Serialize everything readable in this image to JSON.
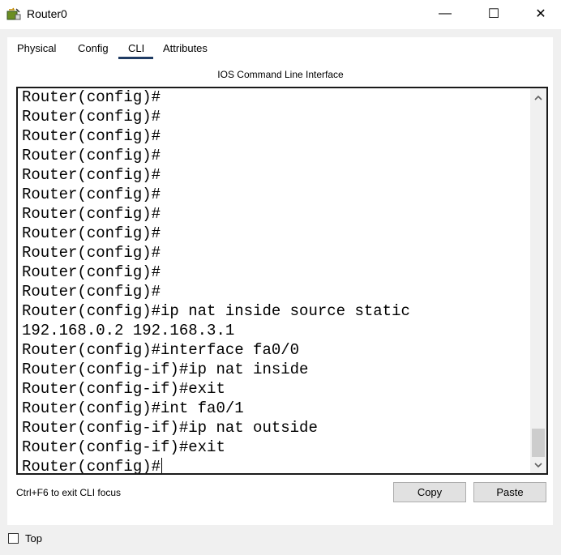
{
  "window": {
    "title": "Router0",
    "minimize_glyph": "—",
    "maximize_glyph": "☐",
    "close_glyph": "✕"
  },
  "tabs": [
    {
      "label": "Physical"
    },
    {
      "label": "Config"
    },
    {
      "label": "CLI",
      "active": true
    },
    {
      "label": "Attributes"
    }
  ],
  "cli": {
    "heading": "IOS Command Line Interface",
    "lines": [
      "Router(config)#",
      "Router(config)#",
      "Router(config)#",
      "Router(config)#",
      "Router(config)#",
      "Router(config)#",
      "Router(config)#",
      "Router(config)#",
      "Router(config)#",
      "Router(config)#",
      "Router(config)#",
      "Router(config)#ip nat inside source static",
      "192.168.0.2 192.168.3.1",
      "Router(config)#interface fa0/0",
      "Router(config-if)#ip nat inside",
      "Router(config-if)#exit",
      "Router(config)#int fa0/1",
      "Router(config-if)#ip nat outside",
      "Router(config-if)#exit",
      "Router(config)#"
    ],
    "hint": "Ctrl+F6 to exit CLI focus",
    "copy_label": "Copy",
    "paste_label": "Paste"
  },
  "footer": {
    "top_label": "Top",
    "top_checked": false
  },
  "icons": {
    "app": "router-app-icon",
    "scroll_up": "chevron-up-icon",
    "scroll_down": "chevron-down-icon"
  },
  "colors": {
    "tab_underline": "#1f3b63",
    "client_bg": "#f0f0f0",
    "terminal_border": "#1a1a1a"
  }
}
